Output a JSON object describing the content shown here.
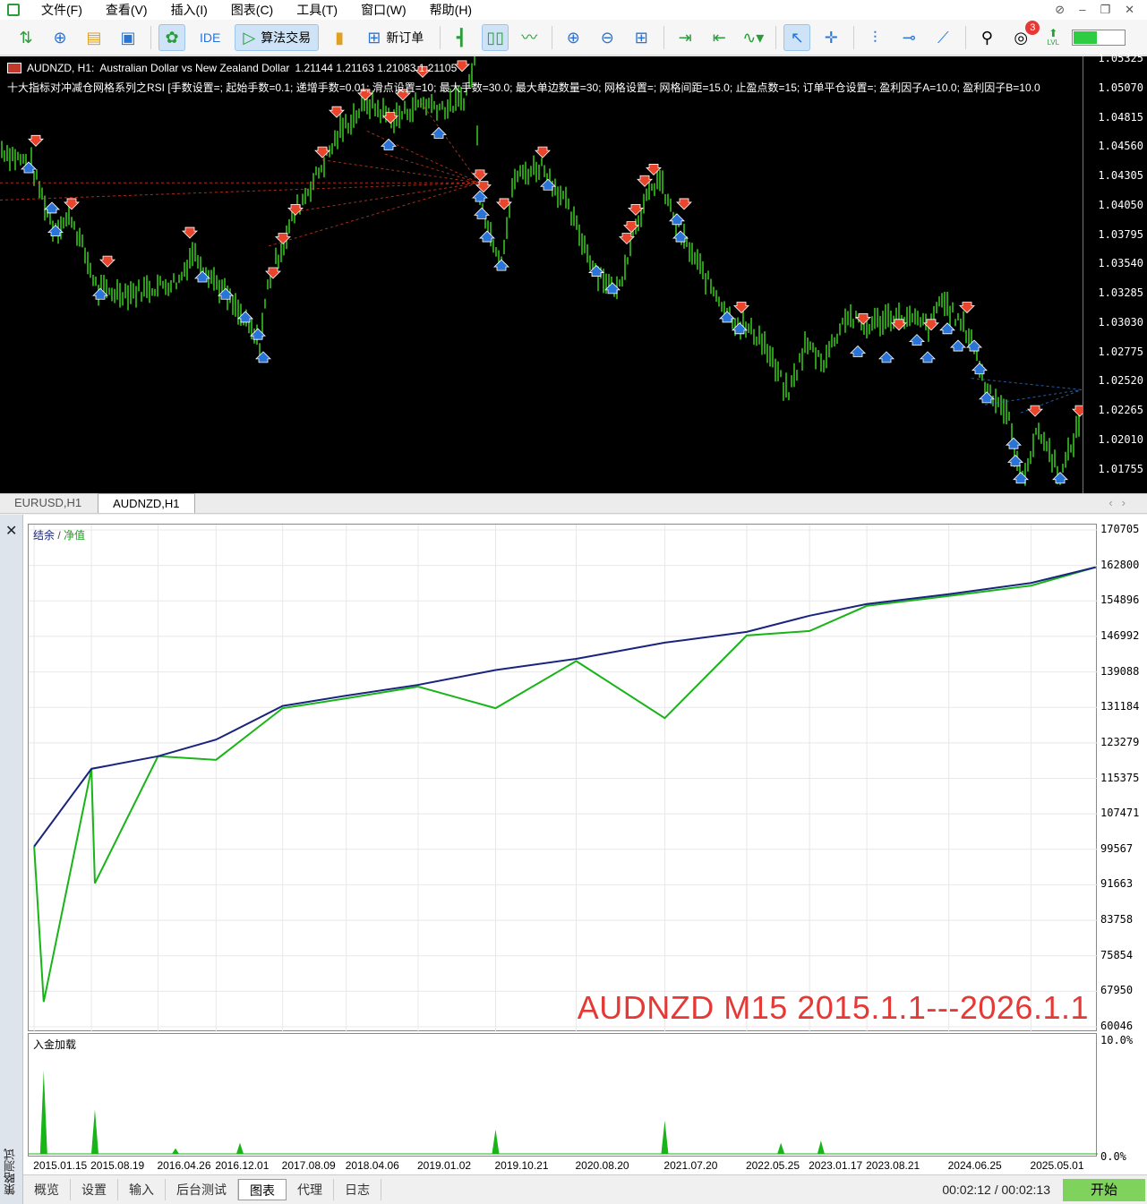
{
  "menubar": {
    "items": [
      "文件(F)",
      "查看(V)",
      "插入(I)",
      "图表(C)",
      "工具(T)",
      "窗口(W)",
      "帮助(H)"
    ]
  },
  "toolbar": {
    "ide_label": "IDE",
    "algo_label": "算法交易",
    "new_order_label": "新订单",
    "notifications_count": "3",
    "level_fill": 0.45,
    "level_label": "LVL"
  },
  "price_chart": {
    "title_symbol": "AUDNZD, H1:",
    "title_desc": "Australian Dollar vs New Zealand Dollar",
    "title_ohlc": "1.21144 1.21163 1.21083 1.21105",
    "ea_params": "十大指标对冲减仓网格系列之RSI [手数设置=; 起始手数=0.1; 递增手数=0.01; 滑点设置=10; 最大手数=30.0; 最大单边数量=30; 网格设置=; 网格间距=15.0; 止盈点数=15; 订单平仓设置=; 盈利因子A=10.0; 盈利因子B=10.0",
    "y_labels": [
      "1.05325",
      "1.05070",
      "1.04815",
      "1.04560",
      "1.04305",
      "1.04050",
      "1.03795",
      "1.03540",
      "1.03285",
      "1.03030",
      "1.02775",
      "1.02520",
      "1.02265",
      "1.02010",
      "1.01755"
    ],
    "y_range": [
      1.0155,
      1.0535
    ],
    "bg_color": "#000000",
    "candle_color": "#35c21c",
    "sell_color": "#e8452c",
    "buy_color": "#2a74d8"
  },
  "chart_tabs": [
    "EURUSD,H1",
    "AUDNZD,H1"
  ],
  "tester": {
    "side_title": "策略测试",
    "legend_balance": "结余",
    "legend_sep": "/",
    "legend_equity": "净值",
    "deposit_legend": "入金加载",
    "overlay": "AUDNZD  M15   2015.1.1---2026.1.1",
    "eq_y_labels": [
      "170705",
      "162800",
      "154896",
      "146992",
      "139088",
      "131184",
      "123279",
      "115375",
      "107471",
      "99567",
      "91663",
      "83758",
      "75854",
      "67950",
      "60046"
    ],
    "dep_y_labels": [
      "10.0%",
      "0.0%"
    ],
    "x_labels": [
      "2015.01.15",
      "2015.08.19",
      "2016.04.26",
      "2016.12.01",
      "2017.08.09",
      "2018.04.06",
      "2019.01.02",
      "2019.10.21",
      "2020.08.20",
      "2021.07.20",
      "2022.05.25",
      "2023.01.17",
      "2023.08.21",
      "2024.06.25",
      "2025.05.01"
    ],
    "tabs": [
      "概览",
      "设置",
      "输入",
      "后台测试",
      "图表",
      "代理",
      "日志"
    ],
    "active_tab": "图表",
    "timer": "00:02:12 / 00:02:13",
    "start_label": "开始",
    "balance_color": "#1a237e",
    "equity_color": "#18b418"
  },
  "chart_data": [
    {
      "type": "line",
      "title": "",
      "series": [
        {
          "name": "结余",
          "x": [
            "2015.01.15",
            "2015.08.19",
            "2016.04.26",
            "2016.12.01",
            "2017.08.09",
            "2018.04.06",
            "2019.01.02",
            "2019.10.21",
            "2020.08.20",
            "2021.07.20",
            "2022.05.25",
            "2023.01.17",
            "2023.08.21",
            "2024.06.25",
            "2025.05.01",
            "2025.12.31"
          ],
          "y": [
            100200,
            117500,
            120300,
            124000,
            131500,
            133800,
            136200,
            139500,
            142000,
            145600,
            148000,
            151600,
            154200,
            156400,
            158900,
            162400
          ]
        },
        {
          "name": "净值",
          "x": [
            "2015.01.15",
            "2015.02.20",
            "2015.08.19",
            "2015.09.01",
            "2016.04.26",
            "2016.12.01",
            "2017.08.09",
            "2018.04.06",
            "2019.01.02",
            "2019.10.21",
            "2020.08.20",
            "2021.07.20",
            "2022.05.25",
            "2023.01.17",
            "2023.08.21",
            "2024.06.25",
            "2025.05.01",
            "2025.12.31"
          ],
          "y": [
            100200,
            65600,
            117500,
            92000,
            120300,
            119500,
            131000,
            133200,
            135800,
            131000,
            141500,
            128800,
            147200,
            148200,
            153800,
            156000,
            158300,
            162400
          ]
        }
      ],
      "ylim": [
        60046,
        170705
      ],
      "grid": true,
      "legend": "top-left"
    },
    {
      "type": "area",
      "title": "",
      "series": [
        {
          "name": "入金加载",
          "x": [
            "2015.02.20",
            "2015.09.01",
            "2016.07.01",
            "2017.03.01",
            "2019.10.21",
            "2021.07.20",
            "2022.10.01",
            "2023.03.01"
          ],
          "y": [
            7.5,
            4.0,
            0.5,
            1.0,
            2.2,
            3.0,
            1.0,
            1.2
          ]
        }
      ],
      "ylim": [
        0,
        10
      ],
      "ylabel": ""
    }
  ]
}
